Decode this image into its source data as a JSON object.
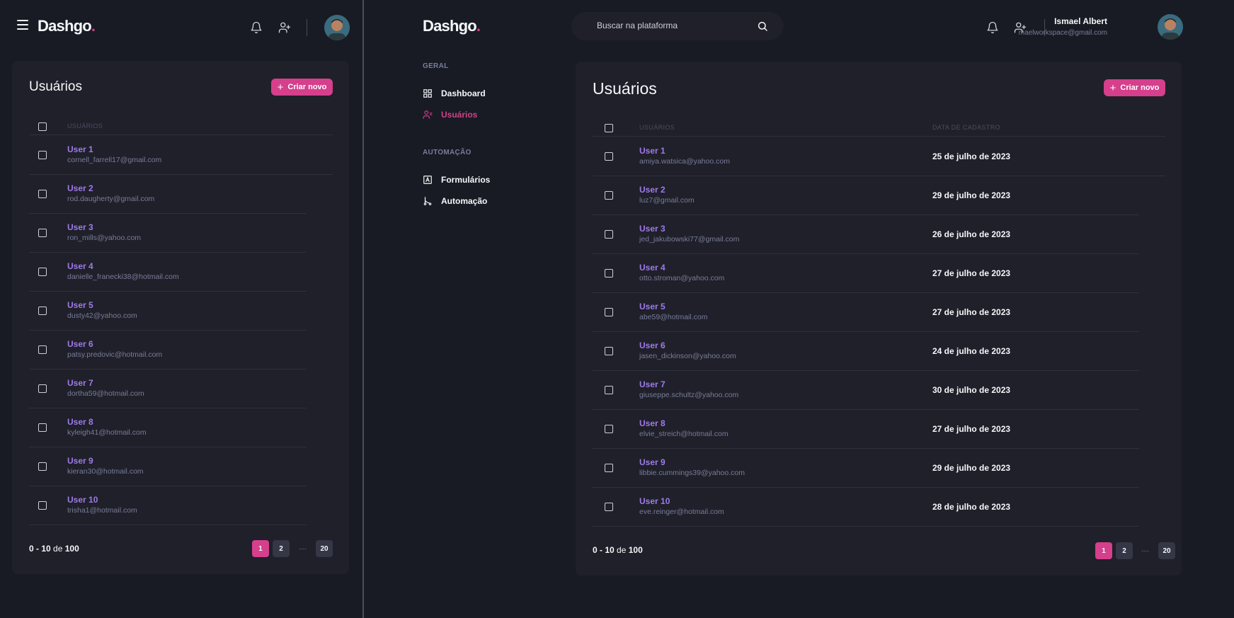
{
  "brand": {
    "name": "Dashgo",
    "dot": "."
  },
  "search": {
    "placeholder": "Buscar na plataforma"
  },
  "profile": {
    "name": "Ismael Albert",
    "email": "maelworkspace@gmail.com"
  },
  "sidebar": {
    "sections": [
      {
        "title": "GERAL",
        "items": [
          {
            "label": "Dashboard",
            "icon": "dashboard-icon",
            "active": false
          },
          {
            "label": "Usuários",
            "icon": "users-icon",
            "active": true
          }
        ]
      },
      {
        "title": "AUTOMAÇÃO",
        "items": [
          {
            "label": "Formulários",
            "icon": "form-icon",
            "active": false
          },
          {
            "label": "Automação",
            "icon": "automation-icon",
            "active": false
          }
        ]
      }
    ]
  },
  "page": {
    "title": "Usuários",
    "create_label": "Criar novo",
    "col_users": "USUÁRIOS",
    "col_date": "DATA DE CADASTRO"
  },
  "users_mobile": [
    {
      "name": "User 1",
      "email": "cornell_farrell17@gmail.com"
    },
    {
      "name": "User 2",
      "email": "rod.daugherty@gmail.com"
    },
    {
      "name": "User 3",
      "email": "ron_mills@yahoo.com"
    },
    {
      "name": "User 4",
      "email": "danielle_franecki38@hotmail.com"
    },
    {
      "name": "User 5",
      "email": "dusty42@yahoo.com"
    },
    {
      "name": "User 6",
      "email": "patsy.predovic@hotmail.com"
    },
    {
      "name": "User 7",
      "email": "dortha59@hotmail.com"
    },
    {
      "name": "User 8",
      "email": "kyleigh41@hotmail.com"
    },
    {
      "name": "User 9",
      "email": "kieran30@hotmail.com"
    },
    {
      "name": "User 10",
      "email": "trisha1@hotmail.com"
    }
  ],
  "users_desktop": [
    {
      "name": "User 1",
      "email": "amiya.watsica@yahoo.com",
      "date": "25 de julho de 2023"
    },
    {
      "name": "User 2",
      "email": "luz7@gmail.com",
      "date": "29 de julho de 2023"
    },
    {
      "name": "User 3",
      "email": "jed_jakubowski77@gmail.com",
      "date": "26 de julho de 2023"
    },
    {
      "name": "User 4",
      "email": "otto.stroman@yahoo.com",
      "date": "27 de julho de 2023"
    },
    {
      "name": "User 5",
      "email": "abe59@hotmail.com",
      "date": "27 de julho de 2023"
    },
    {
      "name": "User 6",
      "email": "jasen_dickinson@yahoo.com",
      "date": "24 de julho de 2023"
    },
    {
      "name": "User 7",
      "email": "giuseppe.schultz@yahoo.com",
      "date": "30 de julho de 2023"
    },
    {
      "name": "User 8",
      "email": "elvie_streich@hotmail.com",
      "date": "27 de julho de 2023"
    },
    {
      "name": "User 9",
      "email": "libbie.cummings39@yahoo.com",
      "date": "29 de julho de 2023"
    },
    {
      "name": "User 10",
      "email": "eve.reinger@hotmail.com",
      "date": "28 de julho de 2023"
    }
  ],
  "pagination": {
    "range": "0 - 10",
    "of": "de",
    "total": "100",
    "pages": [
      "1",
      "2"
    ],
    "dots": "....",
    "last": "20"
  },
  "colors": {
    "accent": "#d53f8c",
    "link": "#9f7aea",
    "bg": "#181b23",
    "card": "#1f2029"
  }
}
